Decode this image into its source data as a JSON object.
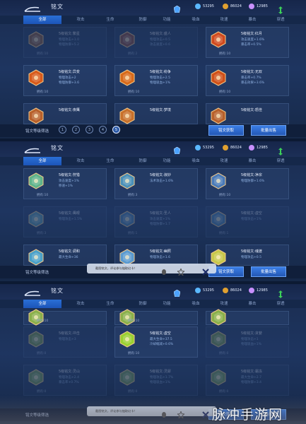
{
  "header": {
    "title": "铭文",
    "currencies": [
      "53295",
      "86024",
      "12985"
    ]
  },
  "tabs": [
    "全部",
    "攻击",
    "生命",
    "防御",
    "功能",
    "吸血",
    "攻速",
    "暴击",
    "穿透"
  ],
  "footer": {
    "filter_label": "铭文等级筛选",
    "pages": [
      "1",
      "2",
      "3",
      "4",
      "5"
    ],
    "get_button": "铭文获取",
    "sell_button": "批量出售"
  },
  "popup": {
    "text": "截图铭文，评论参与抽取幻卡！"
  },
  "panels": [
    {
      "active_page_index": 4,
      "show_popup": false,
      "cards": [
        {
          "name": "5级铭文:繁星",
          "s1": "物理攻击+1.0",
          "s2": "物理防御+5.2",
          "owned": "拥有:10",
          "color": "#8b5a3c",
          "dim": true
        },
        {
          "name": "5级铭文:盛人",
          "s1": "物理攻击+0.5",
          "s2": "攻击速度+0.6",
          "owned": "拥有:2",
          "color": "#8b4a3c",
          "dim": true
        },
        {
          "name": "5级铭文:红月",
          "s1": "攻击速度+1.6%",
          "s2": "暴击率+0.5%",
          "owned": "拥有:10",
          "color": "#d04a1e",
          "dim": false
        },
        {
          "name": "5级铭文:异变",
          "s1": "物理攻击+2",
          "s2": "物理防御+3.6",
          "owned": "拥有:10",
          "color": "#d85a1a",
          "dim": false
        },
        {
          "name": "5级铭文:纷争",
          "s1": "物理攻击+2.5",
          "s2": "物理吸血+1%",
          "owned": "拥有:10",
          "color": "#d86a1a",
          "dim": false
        },
        {
          "name": "5级铭文:无双",
          "s1": "暴击率+0.7%",
          "s2": "暴击效果+3.6%",
          "owned": "拥有:10",
          "color": "#d05018",
          "dim": false
        },
        {
          "name": "5级铭文:夜鹰",
          "s1": "",
          "s2": "",
          "owned": "",
          "color": "#b8602a",
          "dim": false,
          "partial": true
        },
        {
          "name": "5级铭文:梦境",
          "s1": "",
          "s2": "",
          "owned": "",
          "color": "#c8702a",
          "dim": false,
          "partial": true
        },
        {
          "name": "5级铭文:怒佳",
          "s1": "",
          "s2": "",
          "owned": "",
          "color": "#b8602a",
          "dim": false,
          "partial": true
        }
      ]
    },
    {
      "active_page_index": -1,
      "show_popup": true,
      "cards": [
        {
          "name": "5级铭文:狩猎",
          "s1": "攻击速度+1%",
          "s2": "移速+1%",
          "owned": "拥有:10",
          "color": "#5fb38a",
          "dim": false
        },
        {
          "name": "5级铭文:浪妙",
          "s1": "法术攻击+1.6%",
          "s2": "",
          "owned": "拥有:3",
          "color": "#4a90b8",
          "dim": false
        },
        {
          "name": "5级铭文:净宗",
          "s1": "物理防御+1.6%",
          "s2": "",
          "owned": "拥有:10",
          "color": "#4a7ab8",
          "dim": false
        },
        {
          "name": "5级铭文:鹰眼",
          "s1": "物理攻击+1.5%",
          "s2": "",
          "owned": "拥有:3",
          "color": "#5a9ab0",
          "dim": true
        },
        {
          "name": "5级铭文:圣人",
          "s1": "攻击速度+1%",
          "s2": "物理防御+1.7",
          "owned": "拥有:1",
          "color": "#4a80b0",
          "dim": true
        },
        {
          "name": "5级铭文:虚空",
          "s1": "物理攻击+1%",
          "s2": "",
          "owned": "拥有:1",
          "color": "#4a80b0",
          "dim": true
        },
        {
          "name": "5级铭文:调和",
          "s1": "最大生命+36",
          "s2": "",
          "owned": "",
          "color": "#4aa0c8",
          "dim": false,
          "partial": true
        },
        {
          "name": "5级铭文:幽照",
          "s1": "物理攻击+1.6",
          "s2": "",
          "owned": "",
          "color": "#5a9ad0",
          "dim": false,
          "partial": true
        },
        {
          "name": "5级铭文:魂渡",
          "s1": "物理攻击+0.5",
          "s2": "",
          "owned": "",
          "color": "#c8c84a",
          "dim": false,
          "partial": true
        }
      ]
    },
    {
      "active_page_index": -1,
      "show_popup": true,
      "cards": [
        {
          "name": "",
          "s1": "",
          "s2": "",
          "owned": "拥有:10",
          "color": "#8ab04a",
          "dim": false,
          "short": true
        },
        {
          "name": "",
          "s1": "",
          "s2": "",
          "owned": "拥有:10",
          "color": "#8ab04a",
          "dim": false,
          "short": true
        },
        {
          "name": "",
          "s1": "",
          "s2": "",
          "owned": "",
          "color": "#8ab04a",
          "dim": false,
          "short": true
        },
        {
          "name": "5级铭文:冲击",
          "s1": "物理攻击+3",
          "s2": "",
          "owned": "拥有:0",
          "color": "#7a9a4a",
          "dim": true
        },
        {
          "name": "5级铭文:虚空",
          "s1": "最大生命+37.5",
          "s2": "冷却缩减+0.6%",
          "owned": "拥有:10",
          "color": "#9ad030",
          "dim": false
        },
        {
          "name": "5级铭文:贪婪",
          "s1": "物理攻击+1",
          "s2": "物理吸血+1%",
          "owned": "拥有:0",
          "color": "#7a9a4a",
          "dim": true
        },
        {
          "name": "5级铭文:灵山",
          "s1": "物理攻击+2.4",
          "s2": "暴击率+0.7%",
          "owned": "拥有:0",
          "color": "#7aa05a",
          "dim": true
        },
        {
          "name": "5级铭文:灵犀",
          "s1": "物理攻击+1.7%",
          "s2": "物理吸血+1%",
          "owned": "拥有:0",
          "color": "#7aa05a",
          "dim": true
        },
        {
          "name": "5级铭文:霜冻",
          "s1": "最大生命+2.7",
          "s2": "物理防御+3.4",
          "owned": "拥有:0",
          "color": "#7aa05a",
          "dim": true
        }
      ]
    }
  ],
  "watermark": "脉冲手游网",
  "colors": {
    "accent": "#2a6fd6",
    "panel_bg": "#1e3560"
  }
}
